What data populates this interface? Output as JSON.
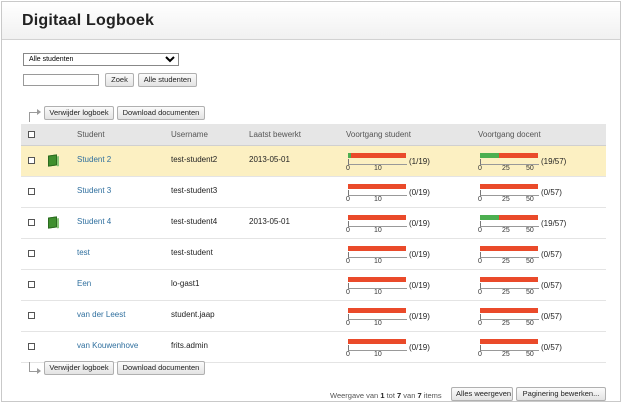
{
  "app": {
    "title": "Digitaal Logboek"
  },
  "filter": {
    "selected": "Alle studenten",
    "search_value": "",
    "search_button": "Zoek",
    "all_button": "Alle studenten"
  },
  "actions": {
    "delete": "Verwijder logboek",
    "download": "Download documenten"
  },
  "table": {
    "headers": {
      "student": "Student",
      "username": "Username",
      "last_edited": "Laatst bewerkt",
      "progress_student": "Voortgang student",
      "progress_teacher": "Voortgang docent"
    },
    "student_scale": [
      "0",
      "10"
    ],
    "teacher_scale": [
      "0",
      "25",
      "50"
    ],
    "rows": [
      {
        "name": "Student 2",
        "username": "test-student2",
        "last_edited": "2013-05-01",
        "has_book": true,
        "selected": true,
        "student_progress": 0.05,
        "student_count": "(1/19)",
        "teacher_progress": 0.33,
        "teacher_count": "(19/57)"
      },
      {
        "name": "Student 3",
        "username": "test-student3",
        "last_edited": "",
        "has_book": false,
        "selected": false,
        "student_progress": 0,
        "student_count": "(0/19)",
        "teacher_progress": 0,
        "teacher_count": "(0/57)"
      },
      {
        "name": "Student 4",
        "username": "test-student4",
        "last_edited": "2013-05-01",
        "has_book": true,
        "selected": false,
        "student_progress": 0,
        "student_count": "(0/19)",
        "teacher_progress": 0.33,
        "teacher_count": "(19/57)"
      },
      {
        "name": "test",
        "username": "test-student",
        "last_edited": "",
        "has_book": false,
        "selected": false,
        "student_progress": 0,
        "student_count": "(0/19)",
        "teacher_progress": 0,
        "teacher_count": "(0/57)"
      },
      {
        "name": "Een",
        "username": "lo-gast1",
        "last_edited": "",
        "has_book": false,
        "selected": false,
        "student_progress": 0,
        "student_count": "(0/19)",
        "teacher_progress": 0,
        "teacher_count": "(0/57)"
      },
      {
        "name": "van der Leest",
        "username": "student.jaap",
        "last_edited": "",
        "has_book": false,
        "selected": false,
        "student_progress": 0,
        "student_count": "(0/19)",
        "teacher_progress": 0,
        "teacher_count": "(0/57)"
      },
      {
        "name": "van Kouwenhove",
        "username": "frits.admin",
        "last_edited": "",
        "has_book": false,
        "selected": false,
        "student_progress": 0,
        "student_count": "(0/19)",
        "teacher_progress": 0,
        "teacher_count": "(0/57)"
      }
    ]
  },
  "footer": {
    "prefix": "Weergave van",
    "from": "1",
    "to_word": "tot",
    "to": "7",
    "of_word": "van",
    "total": "7",
    "suffix": "items",
    "show_all": "Alles weergeven",
    "edit_paging": "Paginering bewerken..."
  },
  "colors": {
    "progress_remaining": "#ea4a2a",
    "progress_done": "#4caf50",
    "selected_row": "#fcf0c2",
    "link": "#2f6f9e"
  }
}
